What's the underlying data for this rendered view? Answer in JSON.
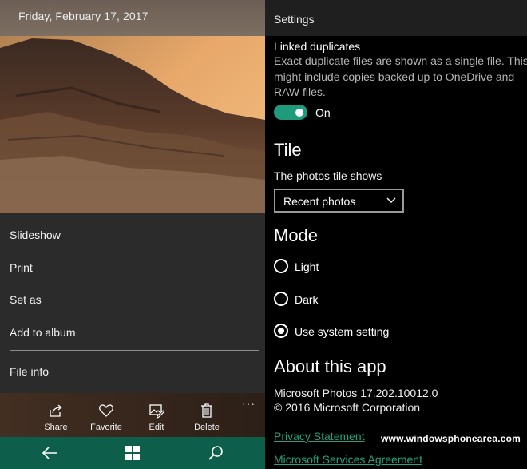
{
  "photo_viewer": {
    "date": "Friday, February 17, 2017",
    "menu": [
      {
        "label": "Slideshow"
      },
      {
        "label": "Print"
      },
      {
        "label": "Set as"
      },
      {
        "label": "Add to album"
      },
      {
        "label": "File info"
      }
    ],
    "actions": [
      {
        "label": "Share",
        "icon": "share-icon"
      },
      {
        "label": "Favorite",
        "icon": "heart-icon"
      },
      {
        "label": "Edit",
        "icon": "edit-image-icon"
      },
      {
        "label": "Delete",
        "icon": "trash-icon"
      }
    ],
    "more": "···",
    "nav": [
      "back-arrow-icon",
      "windows-logo-icon",
      "search-icon"
    ]
  },
  "settings": {
    "title": "Settings",
    "linked_duplicates": {
      "label": "Linked duplicates",
      "description_lines": [
        "Exact duplicate files are shown as a single file. This",
        "might include copies backed up to OneDrive and",
        "RAW files."
      ],
      "toggle_state": "On"
    },
    "tile": {
      "heading": "Tile",
      "label": "The photos tile shows",
      "selected": "Recent photos"
    },
    "mode": {
      "heading": "Mode",
      "options": [
        {
          "label": "Light",
          "selected": false
        },
        {
          "label": "Dark",
          "selected": false
        },
        {
          "label": "Use system setting",
          "selected": true
        }
      ]
    },
    "about": {
      "heading": "About this app",
      "version": "Microsoft Photos 17.202.10012.0",
      "copyright": "© 2016 Microsoft Corporation",
      "links": [
        "Privacy Statement",
        "Microsoft Services Agreement"
      ]
    }
  },
  "watermark": "www.windowsphonearea.com",
  "colors": {
    "accent": "#1e9b7c",
    "link": "#23a383",
    "nav_bar": "#0d5e4a",
    "menu_bg": "#2b2b2b"
  }
}
